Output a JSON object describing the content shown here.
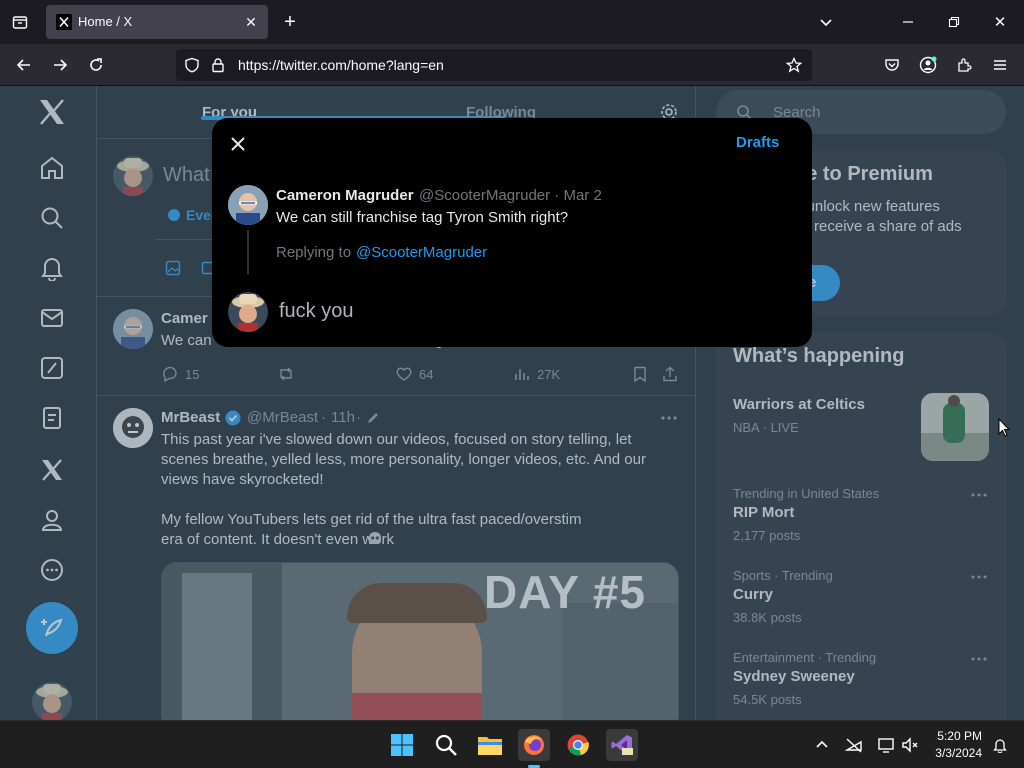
{
  "browser": {
    "tab_title": "Home / X",
    "url": "https://twitter.com/home?lang=en"
  },
  "feed": {
    "tabs": [
      {
        "label": "For you"
      },
      {
        "label": "Following"
      }
    ],
    "composer_placeholder": "What",
    "everyone_label": "Ever",
    "tweet1": {
      "name": "Camer",
      "text_visible": "We can",
      "text_tail": "g",
      "replies": "15",
      "likes": "64",
      "views": "27K"
    },
    "tweet2": {
      "name": "MrBeast",
      "handle": "@MrBeast",
      "time": "11h",
      "text1": "This past year i've slowed down our videos, focused on story telling, let scenes breathe, yelled less, more personality, longer videos, etc. And our views have skyrocketed!",
      "text2": "My fellow YouTubers lets get rid of the ultra fast paced/overstim era of content. It doesn't even work",
      "media_text": "DAY #5"
    }
  },
  "sidebar": {
    "search_placeholder": "Search",
    "premium_title": "be to Premium",
    "premium_line1": "o unlock new features",
    "premium_line2": "le, receive a share of ads",
    "premium_button": "e",
    "happening_title": "What’s happening",
    "trends": [
      {
        "title": "Warriors at Celtics",
        "meta": "NBA · LIVE"
      },
      {
        "meta": "Trending in United States",
        "title": "RIP Mort",
        "count": "2,177 posts"
      },
      {
        "meta": "Sports · Trending",
        "title": "Curry",
        "count": "38.8K posts"
      },
      {
        "meta": "Entertainment · Trending",
        "title": "Sydney Sweeney",
        "count": "54.5K posts"
      }
    ]
  },
  "modal": {
    "drafts_label": "Drafts",
    "original": {
      "name": "Cameron Magruder",
      "handle_time": "@ScooterMagruder · Mar 2",
      "text": "We can still franchise tag Tyron Smith right?"
    },
    "replying_to_prefix": "Replying to",
    "replying_to_handle": "@ScooterMagruder",
    "reply_text": "fuck you"
  },
  "taskbar": {
    "time": "5:20 PM",
    "date": "3/3/2024"
  },
  "colors": {
    "accent": "#1d9bf0",
    "background": "#15202b",
    "modal": "#000000"
  }
}
